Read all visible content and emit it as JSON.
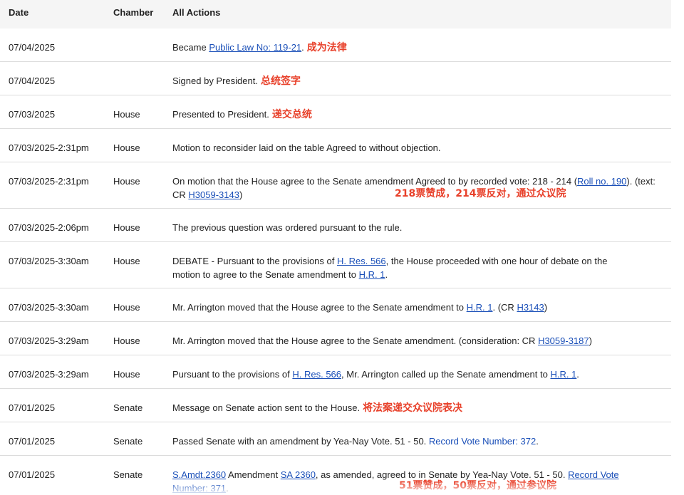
{
  "header": {
    "date": "Date",
    "chamber": "Chamber",
    "actions": "All Actions"
  },
  "rows": [
    {
      "date": "07/04/2025",
      "chamber": "",
      "text_before": "Became ",
      "link1": "Public Law No: 119-21",
      "text_after": ".",
      "note": "成为法律"
    },
    {
      "date": "07/04/2025",
      "chamber": "",
      "text": "Signed by President.",
      "note": "总统签字"
    },
    {
      "date": "07/03/2025",
      "chamber": "House",
      "text": "Presented to President.",
      "note": "递交总统"
    },
    {
      "date": "07/03/2025-2:31pm",
      "chamber": "House",
      "text": "Motion to reconsider laid on the table Agreed to without objection."
    },
    {
      "date": "07/03/2025-2:31pm",
      "chamber": "House",
      "text_before": "On motion that the House agree to the Senate amendment Agreed to by recorded vote: 218 - 214 (",
      "link1": "Roll no. 190",
      "text_mid": "). (text: CR ",
      "link2": "H3059-3143",
      "text_after": ")",
      "note": "218票赞成，214票反对，通过众议院"
    },
    {
      "date": "07/03/2025-2:06pm",
      "chamber": "House",
      "text": "The previous question was ordered pursuant to the rule."
    },
    {
      "date": "07/03/2025-3:30am",
      "chamber": "House",
      "text_before": "DEBATE - Pursuant to the provisions of ",
      "link1": "H. Res. 566",
      "text_mid": ", the House proceeded with one hour of debate on the motion to agree to the Senate amendment to ",
      "link2": "H.R. 1",
      "text_after": "."
    },
    {
      "date": "07/03/2025-3:30am",
      "chamber": "House",
      "text_before": "Mr. Arrington moved that the House agree to the Senate amendment to ",
      "link1": "H.R. 1",
      "text_mid": ". (CR ",
      "link2": "H3143",
      "text_after": ")"
    },
    {
      "date": "07/03/2025-3:29am",
      "chamber": "House",
      "text_before": "Mr. Arrington moved that the House agree to the Senate amendment. (consideration: CR ",
      "link1": "H3059-3187",
      "text_after": ")"
    },
    {
      "date": "07/03/2025-3:29am",
      "chamber": "House",
      "text_before": "Pursuant to the provisions of ",
      "link1": "H. Res. 566",
      "text_mid": ", Mr. Arrington called up the Senate amendment to ",
      "link2": "H.R. 1",
      "text_after": "."
    },
    {
      "date": "07/01/2025",
      "chamber": "Senate",
      "text": "Message on Senate action sent to the House.",
      "note": "将法案递交众议院表决"
    },
    {
      "date": "07/01/2025",
      "chamber": "Senate",
      "text_before": "Passed Senate with an amendment by Yea-Nay Vote. 51 - 50. ",
      "link1": "Record Vote Number: 372",
      "text_after": "."
    },
    {
      "date": "07/01/2025",
      "chamber": "Senate",
      "link1": "S.Amdt.2360",
      "text_before": " Amendment ",
      "link2": "SA 2360",
      "text_mid": ", as amended, agreed to in Senate by Yea-Nay Vote. 51 - 50. ",
      "link3": "Record Vote Number: 371",
      "text_after": ".",
      "note": "51票赞成，50票反对，通过参议院"
    }
  ],
  "colors": {
    "link": "#1a4fb8",
    "annotation": "#e8402a",
    "header_bg": "#f5f5f5",
    "divider": "#dcdcdc"
  }
}
